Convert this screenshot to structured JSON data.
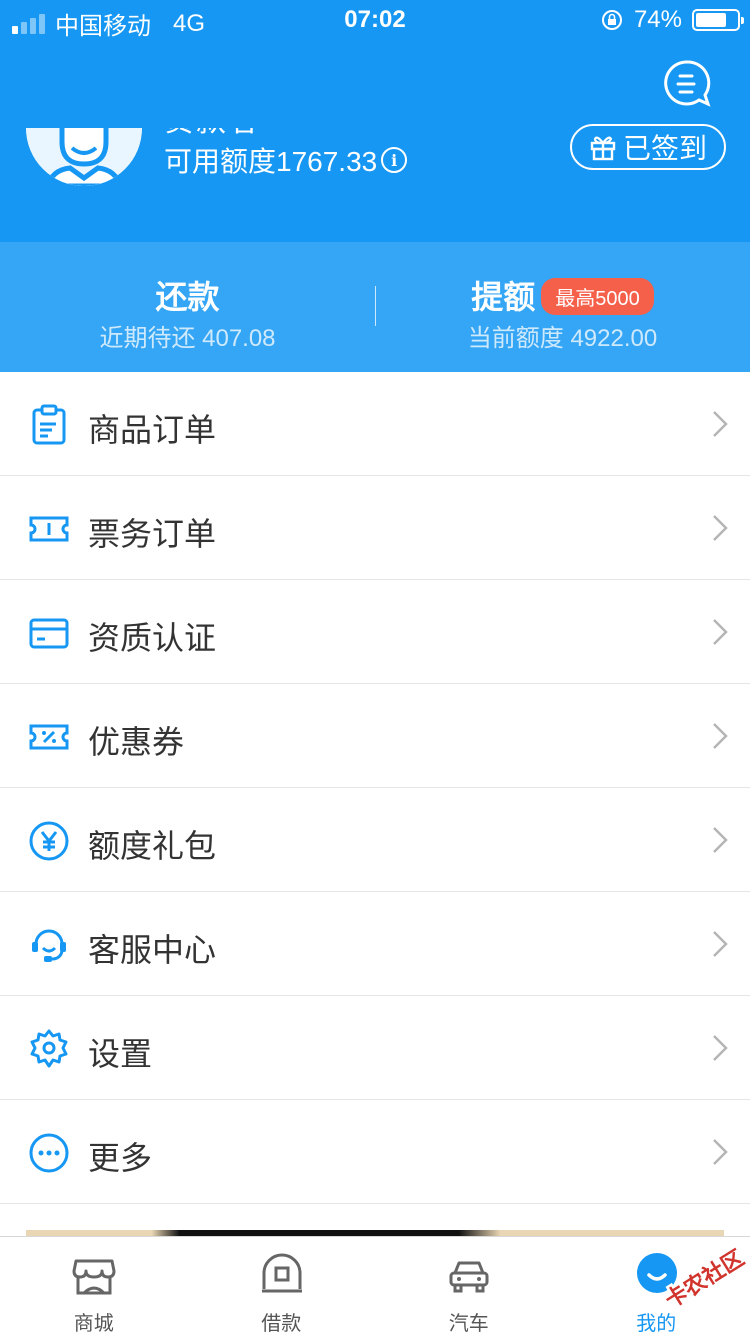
{
  "status_bar": {
    "carrier": "中国移动",
    "network": "4G",
    "time": "07:02",
    "battery": "74%",
    "battery_level": 0.74
  },
  "header": {
    "username_partial": "贷款者",
    "credit_label": "可用额度1767.33",
    "info_icon": "i",
    "signed_button": "已签到",
    "icons": {
      "message": "chat-bubble-icon",
      "gift": "gift-icon",
      "avatar": "user-avatar"
    }
  },
  "actions": {
    "repay": {
      "title": "还款",
      "subtitle": "近期待还 407.08"
    },
    "raise": {
      "title": "提额",
      "badge": "最高5000",
      "subtitle": "当前额度 4922.00"
    }
  },
  "menu": {
    "items": [
      {
        "label": "商品订单",
        "icon": "clipboard-icon"
      },
      {
        "label": "票务订单",
        "icon": "ticket-icon"
      },
      {
        "label": "资质认证",
        "icon": "card-icon"
      },
      {
        "label": "优惠券",
        "icon": "coupon-icon"
      },
      {
        "label": "额度礼包",
        "icon": "yen-icon"
      },
      {
        "label": "客服中心",
        "icon": "headset-icon"
      },
      {
        "label": "设置",
        "icon": "gear-icon"
      },
      {
        "label": "更多",
        "icon": "more-icon"
      }
    ]
  },
  "tabbar": {
    "tabs": [
      {
        "label": "商城",
        "icon": "store-icon"
      },
      {
        "label": "借款",
        "icon": "loan-icon"
      },
      {
        "label": "汽车",
        "icon": "car-icon"
      },
      {
        "label": "我的",
        "icon": "profile-icon",
        "active": true
      }
    ]
  },
  "watermark": {
    "text": "卡农社区"
  },
  "colors": {
    "primary": "#1597f3",
    "strip": "#34a6f5",
    "badge": "#f5604a",
    "text": "#333333"
  }
}
